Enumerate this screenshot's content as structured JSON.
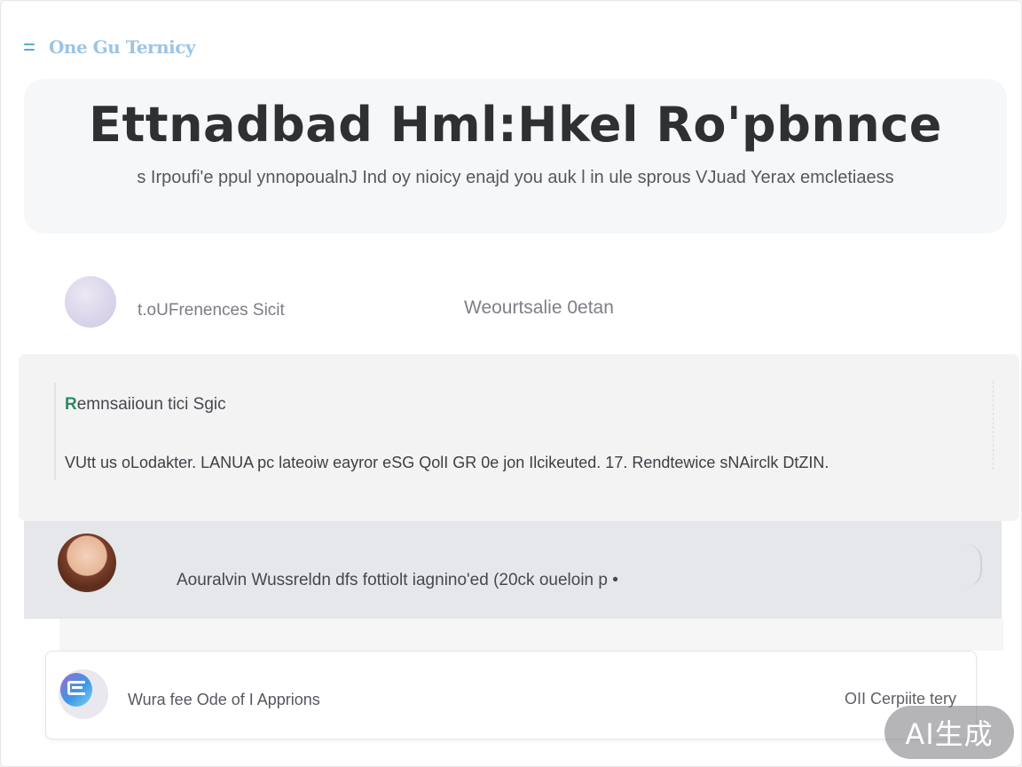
{
  "header": {
    "menu_icon": "hamburger-menu-icon",
    "app_title": "One Gu Ternicy"
  },
  "hero": {
    "title": "Ettnadbad Hml:Hkel Ro'pbnnce",
    "subtitle": "s Irpoufi'e ppul ynnopoualnJ Ind oy nioicy enajd you auk l in ule sprous VJuad Yerax emcletiaess"
  },
  "profile": {
    "label": "t.oUFrenences Sicit",
    "meta": "Weourtsalie 0etan"
  },
  "notice": {
    "title_accent": "R",
    "title_rest": "emnsaiioun tici Sgic",
    "body": "VUtt us oLodakter. LANUA pc lateoiw eayror eSG QolI GR 0e jon Ilcikeuted. 17. Rendtewiсe sNAirclk DtZIN."
  },
  "message": {
    "text": "Aouralvin Wussreldn dfs fottiolt iagnino'ed (20ck oueloin p •"
  },
  "bottom_card": {
    "icon": "app-logo-icon",
    "label": "Wura fee Ode of I Apprions",
    "meta": "OII Cerpiite tery"
  },
  "watermark": {
    "text": "AI生成"
  },
  "colors": {
    "accent_blue": "#5aa7d8",
    "accent_green": "#2d8a61",
    "hero_bg": "#f6f7f9",
    "message_bg": "#e6e7ea"
  }
}
